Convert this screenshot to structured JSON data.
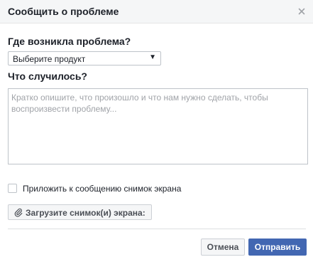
{
  "dialog": {
    "title": "Сообщить о проблеме",
    "close_icon": "close-icon"
  },
  "form": {
    "where_label": "Где возникла проблема?",
    "product_select": {
      "value": "Выберите продукт",
      "arrow_icon": "caret-down-icon"
    },
    "what_label": "Что случилось?",
    "description_placeholder": "Кратко опишите, что произошло и что нам нужно сделать, чтобы воспроизвести проблему...",
    "attach_screenshot_label": "Приложить к сообщению снимок экрана",
    "upload_button_label": "Загрузите снимок(и) экрана:",
    "upload_icon": "paperclip-icon"
  },
  "footer": {
    "cancel_label": "Отмена",
    "submit_label": "Отправить"
  },
  "colors": {
    "header_bg": "#f5f6f7",
    "primary": "#4267b2",
    "text": "#1d2129",
    "placeholder": "#a0a3a8",
    "border": "#bec3c9"
  }
}
